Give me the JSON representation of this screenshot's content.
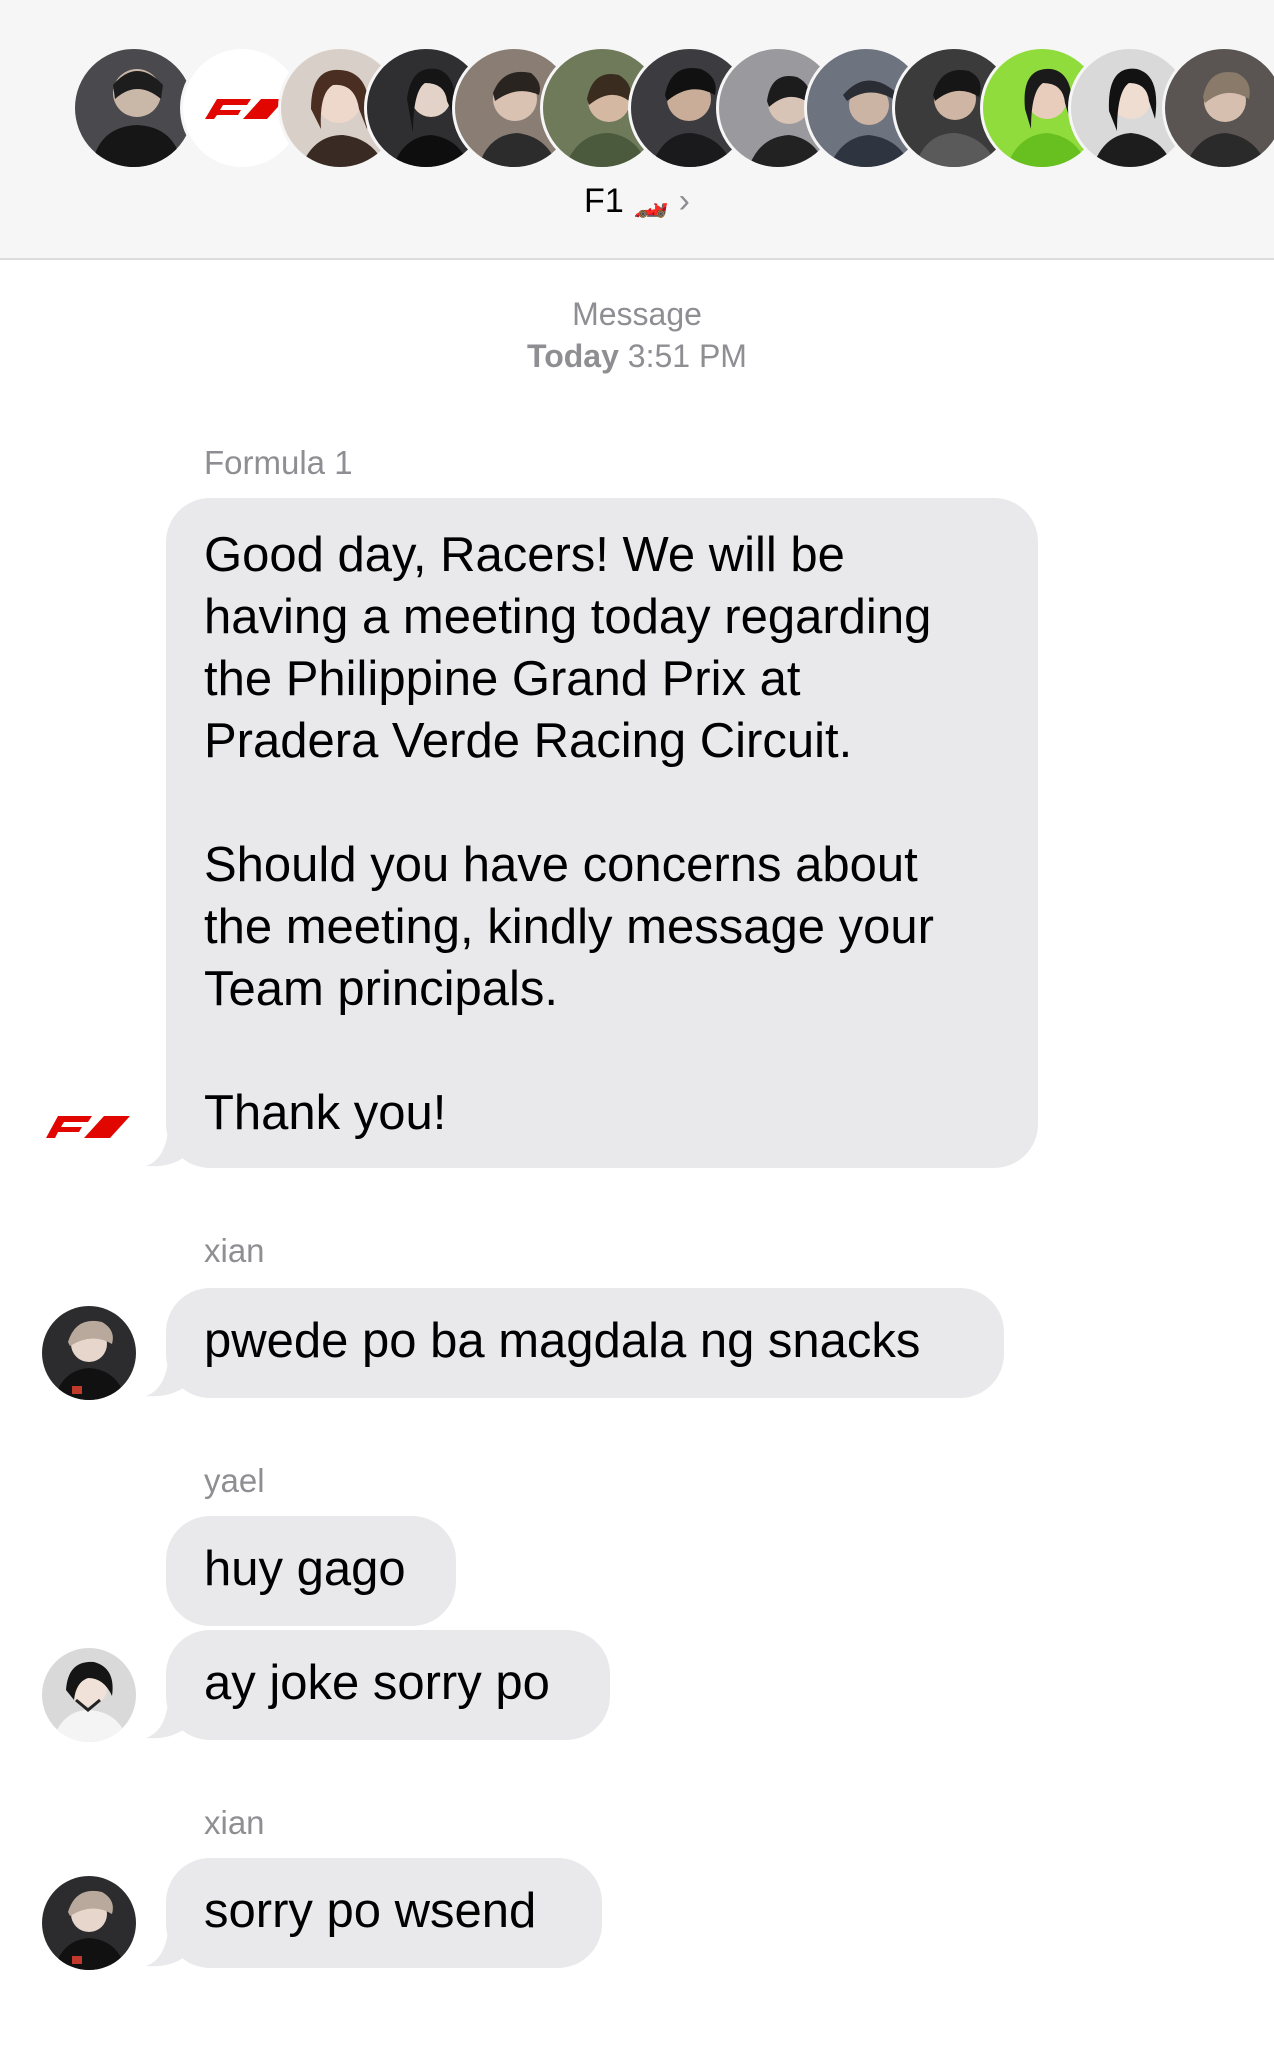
{
  "header": {
    "group_name": "F1",
    "group_emoji": "🏎️",
    "chevron": "›",
    "member_avatars": [
      "avatar-person-1",
      "avatar-f1-logo",
      "avatar-person-2",
      "avatar-person-3",
      "avatar-person-4",
      "avatar-person-5",
      "avatar-person-6",
      "avatar-person-7",
      "avatar-person-8",
      "avatar-person-9",
      "avatar-person-10",
      "avatar-person-11",
      "avatar-person-12"
    ]
  },
  "timestamp": {
    "label": "Message",
    "day": "Today",
    "time": "3:51 PM"
  },
  "colors": {
    "bubble_gray": "#e9e9eb",
    "f1_red": "#e10600",
    "meta_gray": "#8e8e93"
  },
  "messages": [
    {
      "sender": "Formula 1",
      "avatar": "f1-logo",
      "text": "Good day, Racers! We will be\nhaving a meeting today regarding\nthe Philippine Grand Prix at\nPradera Verde Racing Circuit.\n\nShould you have concerns about\nthe meeting, kindly message your\nTeam principals.\n\nThank you!"
    },
    {
      "sender": "xian",
      "avatar": "xian-avatar",
      "text": "pwede po ba magdala ng snacks"
    },
    {
      "sender": "yael",
      "avatar": "",
      "text": "huy gago"
    },
    {
      "sender": "",
      "avatar": "yael-avatar",
      "text": "ay joke sorry po"
    },
    {
      "sender": "xian",
      "avatar": "xian-avatar",
      "text": "sorry po wsend"
    }
  ]
}
